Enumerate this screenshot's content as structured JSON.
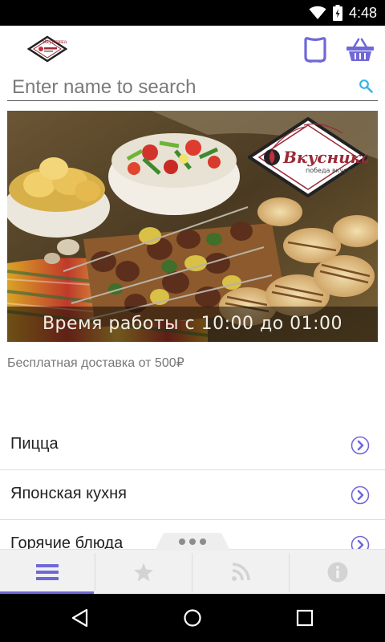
{
  "status_bar": {
    "time": "4:48",
    "icons": [
      "wifi-icon",
      "battery-icon"
    ]
  },
  "app_bar": {
    "logo_text": "Вкусника",
    "actions": [
      "app-icon",
      "basket-icon"
    ],
    "accent_color": "#6f68d8"
  },
  "search": {
    "placeholder": "Enter name to search",
    "value": ""
  },
  "banner": {
    "caption": "Время работы с 10:00 до 01:00",
    "logo_text": "Вкусника",
    "logo_tagline": "победа вкуса"
  },
  "delivery_note": "Бесплатная доставка от 500₽",
  "menu": {
    "items": [
      {
        "label": "Пицца"
      },
      {
        "label": "Японская кухня"
      },
      {
        "label": "Горячие блюда"
      }
    ]
  },
  "bottom_tabs": [
    {
      "icon": "list-icon",
      "selected": true
    },
    {
      "icon": "star-icon",
      "selected": false
    },
    {
      "icon": "rss-icon",
      "selected": false
    },
    {
      "icon": "info-icon",
      "selected": false
    }
  ],
  "nav_bar": {
    "buttons": [
      "back-icon",
      "home-icon",
      "recents-icon"
    ]
  }
}
